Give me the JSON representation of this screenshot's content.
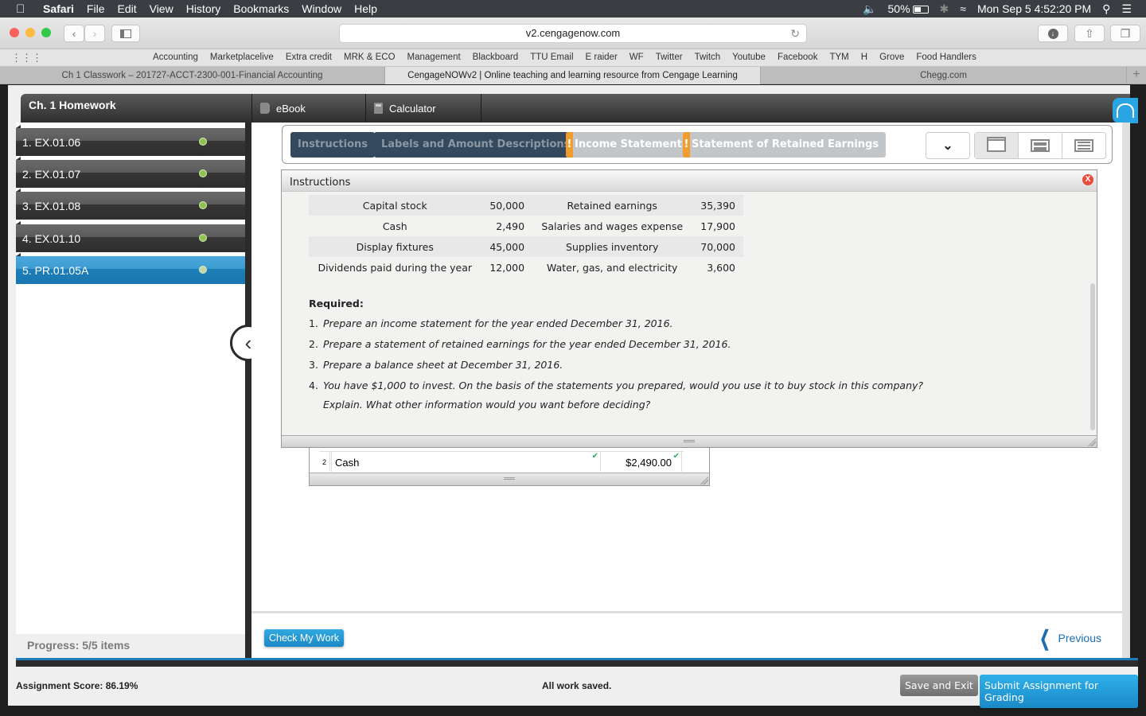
{
  "menubar": {
    "app": "Safari",
    "items": [
      "File",
      "Edit",
      "View",
      "History",
      "Bookmarks",
      "Window",
      "Help"
    ],
    "battery": "50%",
    "datetime": "Mon Sep 5  4:52:20 PM"
  },
  "browser": {
    "url": "v2.cengagenow.com",
    "bookmarks": [
      "Accounting",
      "Marketplacelive",
      "Extra credit",
      "MRK & ECO",
      "Management",
      "Blackboard",
      "TTU Email",
      "E raider",
      "WF",
      "Twitter",
      "Twitch",
      "Youtube",
      "Facebook",
      "TYM",
      "H",
      "Grove",
      "Food Handlers"
    ],
    "tabs": [
      {
        "title": "Ch 1 Classwork – 201727-ACCT-2300-001-Financial Accounting",
        "active": false
      },
      {
        "title": "CengageNOWv2 | Online teaching and learning resource from Cengage Learning",
        "active": true
      },
      {
        "title": "Chegg.com",
        "active": false
      }
    ]
  },
  "app": {
    "assignment_title": "Ch. 1 Homework",
    "tools": [
      "eBook",
      "Calculator"
    ],
    "questions": [
      {
        "label": "1. EX.01.06",
        "status": "complete",
        "active": false
      },
      {
        "label": "2. EX.01.07",
        "status": "complete",
        "active": false
      },
      {
        "label": "3. EX.01.08",
        "status": "complete",
        "active": false
      },
      {
        "label": "4. EX.01.10",
        "status": "complete",
        "active": false
      },
      {
        "label": "5. PR.01.05A",
        "status": "partial",
        "active": true
      }
    ],
    "progress": "Progress:  5/5 items"
  },
  "question_tabs": [
    {
      "label": "Instructions",
      "state": "done"
    },
    {
      "label": "Labels and Amount Descriptions",
      "state": "done"
    },
    {
      "label": "Income Statement",
      "state": "incomplete",
      "flag": "!"
    },
    {
      "label": "Statement of Retained Earnings",
      "state": "incomplete",
      "flag": "!"
    }
  ],
  "instructions": {
    "title": "Instructions",
    "close": "X",
    "rows": [
      {
        "label1": "Capital stock",
        "value1": "50,000",
        "label2": "Retained earnings",
        "value2": "35,390"
      },
      {
        "label1": "Cash",
        "value1": "2,490",
        "label2": "Salaries and wages expense",
        "value2": "17,900"
      },
      {
        "label1": "Display fixtures",
        "value1": "45,000",
        "label2": "Supplies inventory",
        "value2": "70,000"
      },
      {
        "label1": "Dividends paid during the year",
        "value1": "12,000",
        "label2": "Water, gas, and electricity",
        "value2": "3,600"
      }
    ],
    "required_heading": "Required:",
    "required": [
      {
        "n": "1.",
        "text": "Prepare an income statement for the year ended December 31, 2016."
      },
      {
        "n": "2.",
        "text": "Prepare a statement of retained earnings for the year ended December 31, 2016."
      },
      {
        "n": "3.",
        "text": "Prepare a balance sheet at December 31, 2016."
      },
      {
        "n": "4.",
        "text": "You have $1,000 to invest. On the basis of the statements you prepared, would you use it to buy stock in this company?",
        "continuation": "Explain. What other information would you want before deciding?"
      }
    ]
  },
  "answer_row": {
    "num": "2",
    "label": "Cash",
    "value": "$2,490.00"
  },
  "footer": {
    "check_my_work": "Check My Work",
    "previous": "Previous",
    "score": "Assignment Score: 86.19%",
    "saved": "All work saved.",
    "save_exit": "Save and Exit",
    "submit": "Submit Assignment for Grading"
  }
}
